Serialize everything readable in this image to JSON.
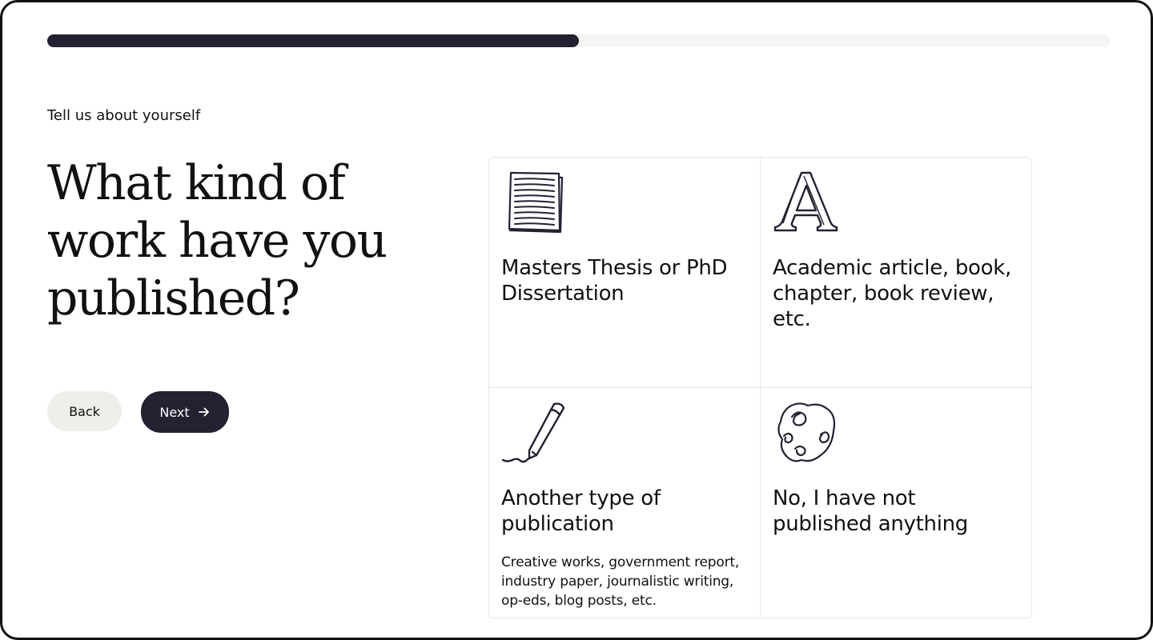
{
  "progress": {
    "fraction": 0.5
  },
  "eyebrow": "Tell us about yourself",
  "question": "What kind of work have you published?",
  "buttons": {
    "back_label": "Back",
    "next_label": "Next",
    "next_icon": "arrow-right-icon"
  },
  "options": [
    {
      "icon": "stacked-papers-icon",
      "title": "Masters Thesis or PhD Dissertation",
      "description": ""
    },
    {
      "icon": "letter-a-icon",
      "title": "Academic article, book, chapter, book review, etc.",
      "description": ""
    },
    {
      "icon": "pencil-icon",
      "title": "Another type of publication",
      "description": "Creative works, government report, industry paper, journalistic writing, op-eds, blog posts, etc."
    },
    {
      "icon": "scribble-icon",
      "title": "No, I have not published anything",
      "description": ""
    }
  ],
  "colors": {
    "primary": "#222233",
    "track": "#f5f5f4",
    "back_button": "#efeeea",
    "border": "#e6e6e6",
    "text": "#111111"
  }
}
